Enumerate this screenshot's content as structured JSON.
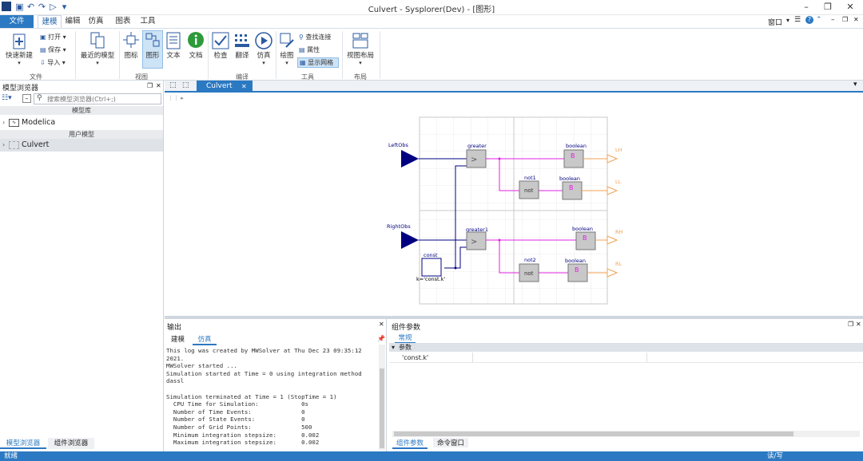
{
  "window": {
    "title": "Culvert - Sysplorer(Dev) - [图形]",
    "right_menu": "窗口"
  },
  "ribbon_tabs": [
    "文件",
    "建模",
    "编辑",
    "仿真",
    "图表",
    "工具"
  ],
  "ribbon": {
    "quick_new": "快速新建",
    "open": "打开",
    "save": "保存",
    "import": "导入",
    "recent": "最近的模型",
    "group_file": "文件",
    "icon_view": "图标",
    "diagram_view": "图形",
    "text_view": "文本",
    "doc_view": "文档",
    "group_view": "视图",
    "check": "检查",
    "translate": "翻译",
    "simulate": "仿真",
    "group_compile": "编译",
    "draw": "绘图",
    "find_conn": "查找连接",
    "properties": "属性",
    "show_grid": "显示网格",
    "group_tools": "工具",
    "view_layout": "视图布局",
    "group_layout": "布局"
  },
  "left_panel": {
    "title": "模型浏览器",
    "search_placeholder": "搜索模型浏览器(Ctrl+;)",
    "section_library": "模型库",
    "lib_item": "Modelica",
    "section_user": "用户模型",
    "user_item": "Culvert",
    "tab_model": "模型浏览器",
    "tab_component": "组件浏览器"
  },
  "doc_tab": "Culvert",
  "diagram": {
    "left_obs": "LeftObs",
    "right_obs": "RightObs",
    "greater": "greater",
    "greater1": "greater1",
    "not1": "not1",
    "not2": "not2",
    "boolean": "boolean",
    "const": "const",
    "const_k": "k='const.k'",
    "not_text": "not",
    "b_text": "B",
    "out_lh": "LH",
    "out_ll": "LL",
    "out_rh": "RH",
    "out_rl": "RL"
  },
  "output": {
    "title": "输出",
    "tab_model": "建模",
    "tab_sim": "仿真",
    "log": "This log was created by MWSolver at Thu Dec 23 09:35:12\n2021.\nMWSolver started ...\nSimulation started at Time = 0 using integration method\ndassl\n\nSimulation terminated at Time = 1 (StopTime = 1)\n  CPU Time for Simulation:            0s\n  Number of Time Events:              0\n  Number of State Events:             0\n  Number of Grid Points:              500\n  Minimum integration stepsize:       0.002\n  Maximum integration stepsize:       0.002"
  },
  "params": {
    "title": "组件参数",
    "tab_general": "常规",
    "group": "参数",
    "param_name": "'const.k'",
    "bottom_tab_params": "组件参数",
    "bottom_tab_cmd": "命令窗口"
  },
  "status": {
    "left": "就绪",
    "right": "读/写"
  },
  "colors": {
    "accent": "#2b79c2",
    "signal": "#e020e0",
    "real_signal": "#000080",
    "output": "#f0a050"
  }
}
